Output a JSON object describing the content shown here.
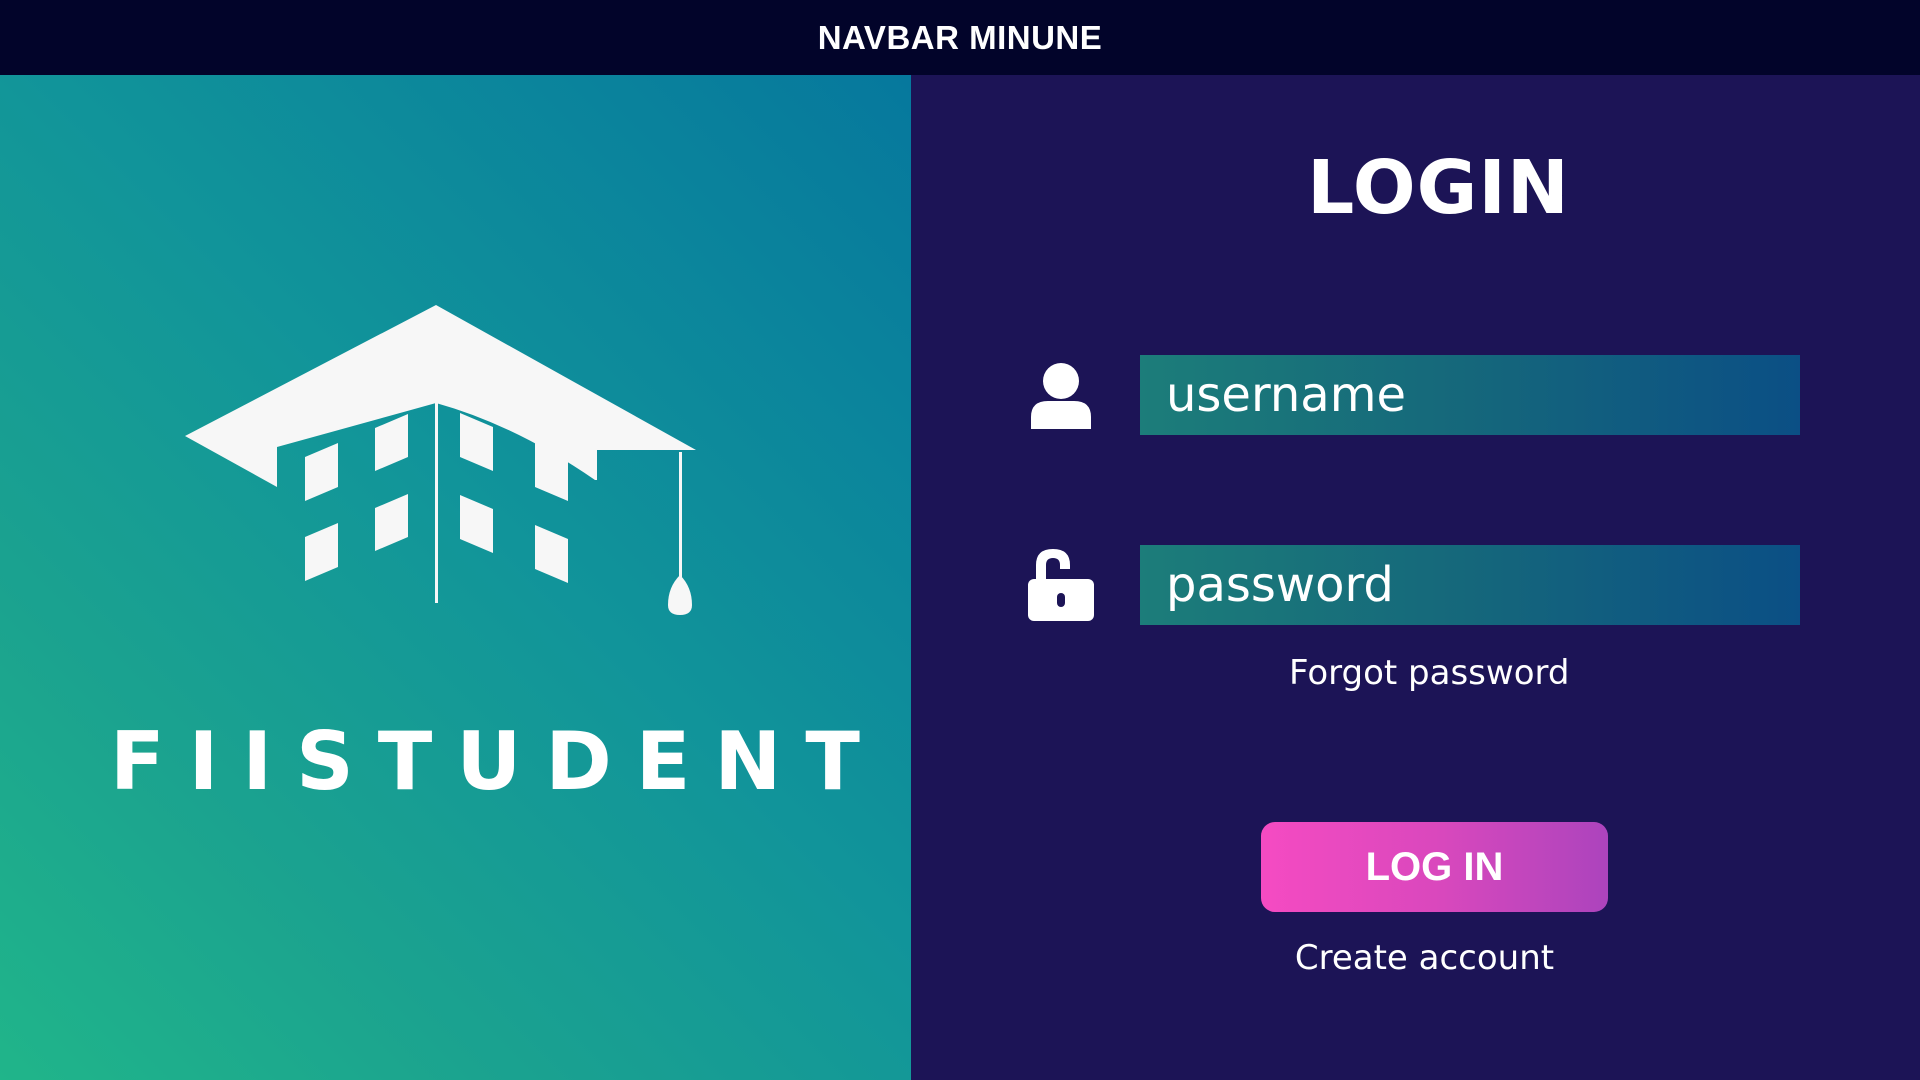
{
  "navbar": {
    "title": "NAVBAR MINUNE"
  },
  "brand": {
    "name": "FIISTUDENT",
    "logo_icon": "graduation-cap-building-logo"
  },
  "login": {
    "heading": "LOGIN",
    "username": {
      "icon": "user-icon",
      "placeholder": "username",
      "value": ""
    },
    "password": {
      "icon": "unlock-icon",
      "placeholder": "password",
      "value": ""
    },
    "forgot_password": "Forgot password",
    "submit_label": "LOG IN",
    "create_account": "Create account"
  },
  "colors": {
    "navbar_bg": "#02042a",
    "left_gradient_top": "#06789d",
    "left_gradient_bottom": "#20b58a",
    "right_bg": "#1c1456",
    "button_start": "#f54bc2",
    "button_end": "#ac44bd"
  }
}
